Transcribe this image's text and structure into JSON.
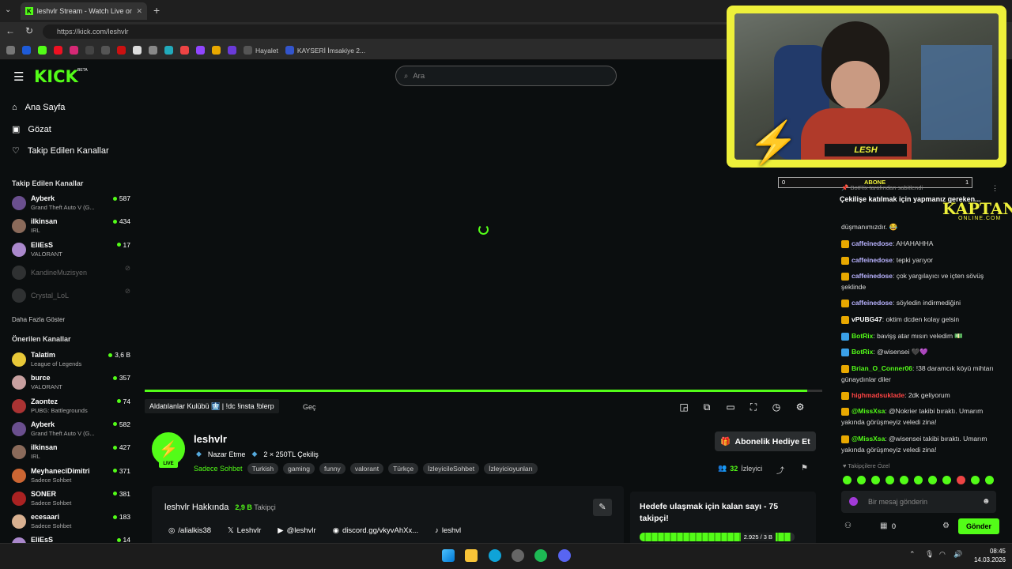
{
  "browser": {
    "tab_title": "leshvlr Stream - Watch Live on Kick",
    "url": "https://kick.com/leshvlr",
    "bookmarks": [
      {
        "label": "Hayalet"
      },
      {
        "label": "KAYSERİ İmsakiye 2..."
      }
    ]
  },
  "header": {
    "logo": "KICK",
    "search_placeholder": "Ara"
  },
  "sidebar": {
    "nav": [
      {
        "label": "Ana Sayfa"
      },
      {
        "label": "Gözat"
      },
      {
        "label": "Takip Edilen Kanallar"
      }
    ],
    "followed_title": "Takip Edilen Kanallar",
    "followed": [
      {
        "name": "Ayberk",
        "game": "Grand Theft Auto V (G...",
        "viewers": "587",
        "color": "#6a4f8e"
      },
      {
        "name": "ilkinsan",
        "game": "IRL",
        "viewers": "434",
        "color": "#8a6a5a"
      },
      {
        "name": "EliEsS",
        "game": "VALORANT",
        "viewers": "17",
        "color": "#aa88cc"
      },
      {
        "name": "KandineMuzisyen",
        "game": "",
        "viewers": "",
        "color": "#666"
      },
      {
        "name": "Crystal_LoL",
        "game": "",
        "viewers": "",
        "color": "#666"
      }
    ],
    "show_more": "Daha Fazla Göster",
    "recommended_title": "Önerilen Kanallar",
    "recommended": [
      {
        "name": "Talatim",
        "game": "League of Legends",
        "viewers": "3,6 B",
        "color": "#e8c838"
      },
      {
        "name": "burce",
        "game": "VALORANT",
        "viewers": "357",
        "color": "#c8a0a0"
      },
      {
        "name": "Zaontez",
        "game": "PUBG: Battlegrounds",
        "viewers": "74",
        "color": "#aa3333"
      },
      {
        "name": "Ayberk",
        "game": "Grand Theft Auto V (G...",
        "viewers": "582",
        "color": "#6a4f8e"
      },
      {
        "name": "ilkinsan",
        "game": "IRL",
        "viewers": "427",
        "color": "#8a6a5a"
      },
      {
        "name": "MeyhaneciDimitri",
        "game": "Sadece Sohbet",
        "viewers": "371",
        "color": "#cc6633"
      },
      {
        "name": "SONER",
        "game": "Sadece Sohbet",
        "viewers": "381",
        "color": "#aa2222"
      },
      {
        "name": "ecesaari",
        "game": "Sadece Sohbet",
        "viewers": "183",
        "color": "#d8b090"
      },
      {
        "name": "EliEsS",
        "game": "",
        "viewers": "14",
        "color": "#aa88cc"
      }
    ]
  },
  "player": {
    "stream_title": "Aldatılanlar Kulübü 🩻 | !dc !insta !blerp",
    "skip": "Geç"
  },
  "channel": {
    "name": "leshvlr",
    "live_label": "LIVE",
    "subtitle": [
      "Nazar Etme",
      "2 × 250TL Çekiliş"
    ],
    "category": "Sadece Sohbet",
    "tags": [
      "Turkish",
      "gaming",
      "funny",
      "valorant",
      "Türkçe",
      "İzleyicileSohbet",
      "İzleyicioyunları"
    ],
    "gift_button": "Abonelik Hediye Et",
    "viewers_count": "32",
    "viewers_label": "İzleyici",
    "about_title": "leshvlr Hakkında",
    "followers_count": "2,9 B",
    "followers_label": "Takipçi",
    "socials": [
      "/alialkis38",
      "Leshvlr",
      "@leshvlr",
      "discord.gg/vkyvAhXx...",
      "leshvl"
    ],
    "goal_title": "Hedefe ulaşmak için kalan sayı - 75 takipçi!",
    "goal_progress": "2.925 / 3 B",
    "goal_fraction": 0.975
  },
  "overlay": {
    "webcam_name": "LESH",
    "abone_label": "ABONE",
    "abone_left": "0",
    "abone_right": "1",
    "kaptan": "KAPTAN",
    "kaptan_sub": "ONLINE.COM"
  },
  "chat": {
    "pinned_by": "BotRix tarafından sabitlendi",
    "pinned_text": "Çekilişe katılmak için yapmanız gereken...",
    "messages": [
      {
        "user": "",
        "text": "düşmanımızdır. 😂",
        "color": "#ddd"
      },
      {
        "user": "caffeinedose",
        "text": "AHAHAHHA",
        "color": "#b9b3ff"
      },
      {
        "user": "caffeinedose",
        "text": "tepki yarıyor",
        "color": "#b9b3ff"
      },
      {
        "user": "caffeinedose",
        "text": "çok yargılayıcı ve içten sövüş şeklinde",
        "color": "#b9b3ff"
      },
      {
        "user": "caffeinedose",
        "text": "söyledin indirmediğini",
        "color": "#b9b3ff"
      },
      {
        "user": "vPUBG47",
        "text": "oktim dcden kolay gelsin",
        "color": "#ffffff"
      },
      {
        "user": "BotRix",
        "text": "bavişş atar mısın veledim 💵",
        "color": "#53fc18"
      },
      {
        "user": "BotRix",
        "text": "@wisensei 🖤💜",
        "color": "#53fc18"
      },
      {
        "user": "Brian_O_Conner06",
        "text": "!38 daramcık köyü mihtarı günaydınlar diler",
        "color": "#53fc18"
      },
      {
        "user": "highmadsuklade",
        "text": "2dk geliyorum",
        "color": "#ff4444"
      },
      {
        "user": "@MissXsa",
        "text": "@Nokrier takibi bıraktı. Umarım yakında görüşmeyiz veledi zina!",
        "color": "#53fc18"
      },
      {
        "user": "@MissXsa",
        "text": "@wisensei takibi bıraktı. Umarım yakında görüşmeyiz veledi zina!",
        "color": "#53fc18"
      }
    ],
    "followers_only": "Takipçilere Özel",
    "input_placeholder": "Bir mesaj gönderin",
    "points": "0",
    "send": "Gönder"
  },
  "taskbar": {
    "time": "08:45",
    "date": "14.03.2026"
  }
}
